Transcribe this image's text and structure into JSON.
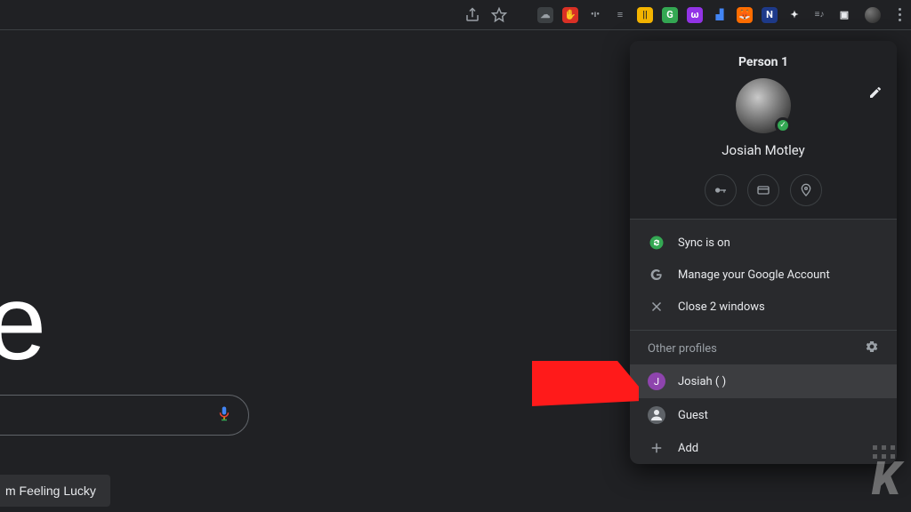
{
  "toolbar": {
    "share_icon": "share",
    "star_icon": "star",
    "extensions": [
      {
        "name": "ext-cloud",
        "bg": "#444",
        "glyph": "☁"
      },
      {
        "name": "ext-adblock",
        "bg": "#d93025",
        "glyph": "✋"
      },
      {
        "name": "ext-dots",
        "bg": "#555",
        "glyph": "•••"
      },
      {
        "name": "ext-lines",
        "bg": "#555",
        "glyph": "≡"
      },
      {
        "name": "ext-yellow",
        "bg": "#f4b400",
        "glyph": "||"
      },
      {
        "name": "ext-green",
        "bg": "#34a853",
        "glyph": "G"
      },
      {
        "name": "ext-omega",
        "bg": "#9334e6",
        "glyph": "ω"
      },
      {
        "name": "ext-chart",
        "bg": "#4285f4",
        "glyph": "▞"
      },
      {
        "name": "ext-brave",
        "bg": "#ff6d00",
        "glyph": "🦊"
      },
      {
        "name": "ext-n",
        "bg": "#1e3a8a",
        "glyph": "N"
      },
      {
        "name": "ext-puzzle",
        "bg": "#555",
        "glyph": "✦"
      },
      {
        "name": "ext-music",
        "bg": "#555",
        "glyph": "≡♪"
      },
      {
        "name": "ext-reader",
        "bg": "#555",
        "glyph": "▣"
      }
    ]
  },
  "google": {
    "logo_fragment": "gle",
    "lucky_label": "m Feeling Lucky"
  },
  "panel": {
    "title": "Person 1",
    "profile_name": "Josiah Motley",
    "chips": {
      "passwords": "key",
      "payments": "card",
      "addresses": "pin"
    },
    "rows": {
      "sync": "Sync is on",
      "manage": "Manage your Google Account",
      "close": "Close 2 windows"
    },
    "other_profiles_label": "Other profiles",
    "profiles": {
      "josiah": {
        "initial": "J",
        "label": "Josiah (                          )"
      },
      "guest": "Guest",
      "add": "Add"
    }
  },
  "watermark": "K"
}
